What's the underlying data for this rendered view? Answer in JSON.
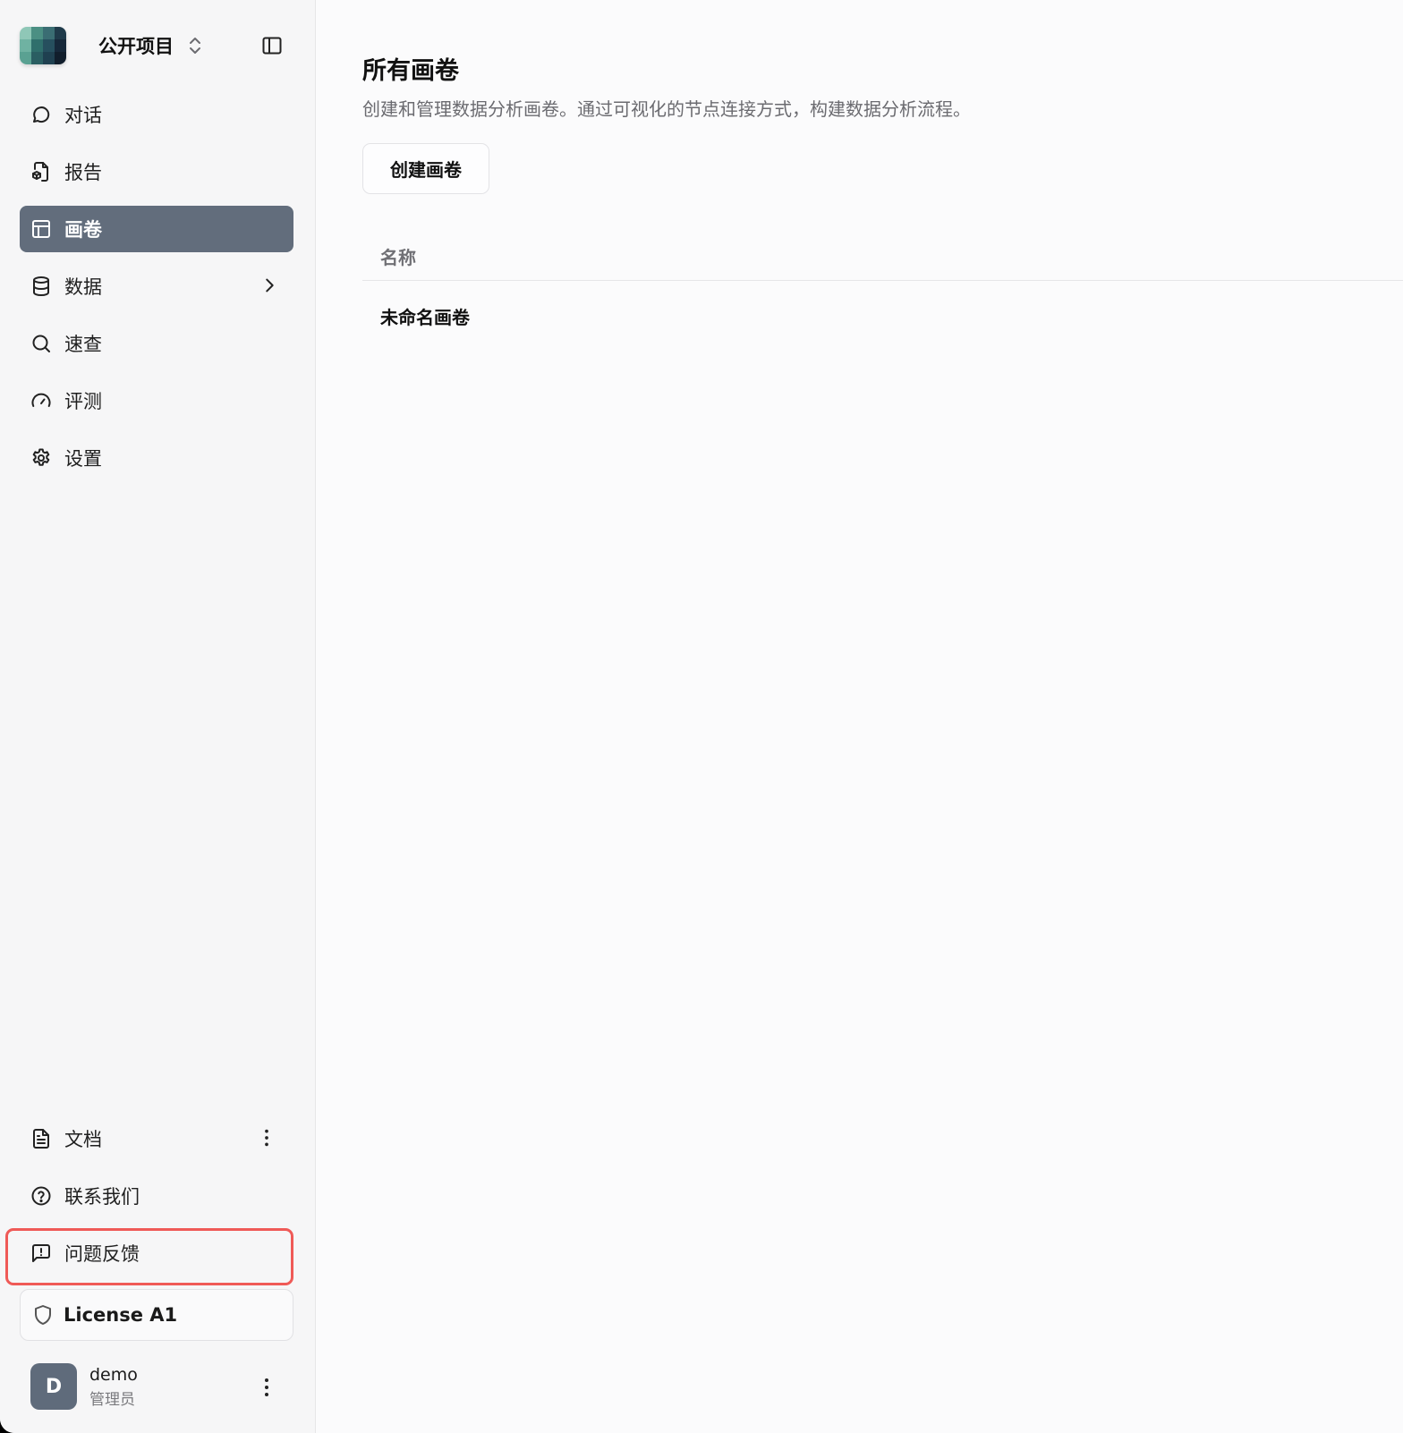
{
  "project": {
    "name": "公开项目"
  },
  "nav": {
    "items": [
      {
        "label": "对话"
      },
      {
        "label": "报告"
      },
      {
        "label": "画卷"
      },
      {
        "label": "数据"
      },
      {
        "label": "速查"
      },
      {
        "label": "评测"
      },
      {
        "label": "设置"
      }
    ]
  },
  "bottom": {
    "items": [
      {
        "label": "文档"
      },
      {
        "label": "联系我们"
      },
      {
        "label": "问题反馈"
      }
    ],
    "license": "License A1"
  },
  "user": {
    "initial": "D",
    "name": "demo",
    "role": "管理员"
  },
  "main": {
    "title": "所有画卷",
    "description": "创建和管理数据分析画卷。通过可视化的节点连接方式，构建数据分析流程。",
    "create_button": "创建画卷",
    "table": {
      "columns": [
        "名称"
      ],
      "rows": [
        {
          "name": "未命名画卷"
        }
      ]
    }
  },
  "colors": {
    "active_nav": "#626d7c",
    "highlight": "#ef5a57",
    "avatar": "#5f6b7b"
  }
}
